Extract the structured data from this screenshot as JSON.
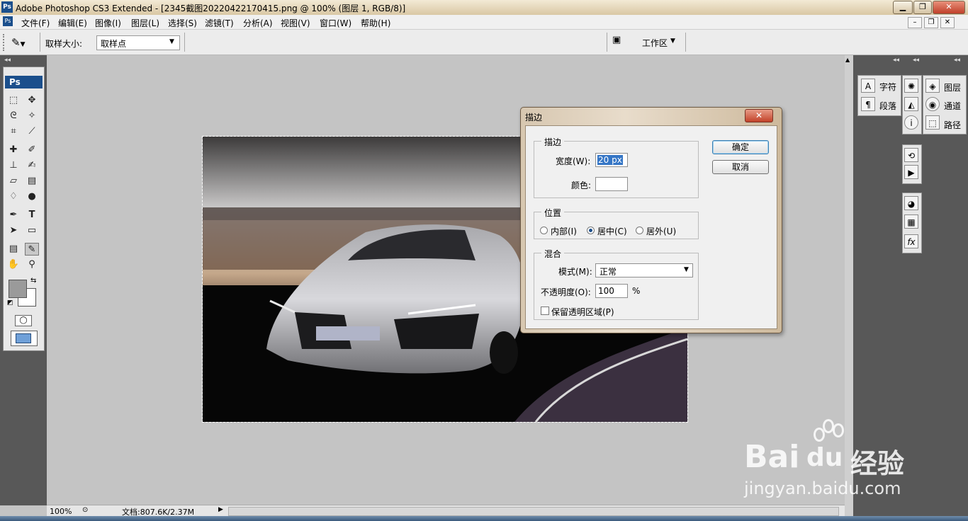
{
  "window": {
    "title": "Adobe Photoshop CS3 Extended - [2345截图20220422170415.png @ 100% (图层 1, RGB/8)]",
    "app_icon": "Ps"
  },
  "menubar": {
    "items": [
      "文件(F)",
      "编辑(E)",
      "图像(I)",
      "图层(L)",
      "选择(S)",
      "滤镜(T)",
      "分析(A)",
      "视图(V)",
      "窗口(W)",
      "帮助(H)"
    ]
  },
  "options": {
    "sample_size_label": "取样大小:",
    "sample_size_value": "取样点",
    "workspace_label": "工作区"
  },
  "toolbox": {
    "logo": "Ps"
  },
  "right_panels": {
    "char": "字符",
    "para": "段落",
    "layers": "图层",
    "channels": "通道",
    "paths": "路径"
  },
  "dialog": {
    "title": "描边",
    "stroke_group": "描边",
    "width_label": "宽度(W):",
    "width_value": "20 px",
    "color_label": "颜色:",
    "color_value": "#ffffff",
    "position_group": "位置",
    "position_options": [
      "内部(I)",
      "居中(C)",
      "居外(U)"
    ],
    "position_selected": "居中(C)",
    "blend_group": "混合",
    "mode_label": "模式(M):",
    "mode_value": "正常",
    "opacity_label": "不透明度(O):",
    "opacity_value": "100",
    "opacity_unit": "%",
    "preserve_label": "保留透明区域(P)",
    "preserve_checked": false,
    "ok_label": "确定",
    "cancel_label": "取消"
  },
  "status": {
    "zoom": "100%",
    "doc_info": "文档:807.6K/2.37M"
  },
  "watermark": {
    "brand": "Bai",
    "brand2": "du",
    "brand3": "经验",
    "url": "jingyan.baidu.com"
  },
  "colors": {
    "accent": "#1b4f8c",
    "panel_dark": "#585858",
    "canvas_bg": "#c4c4c4"
  }
}
